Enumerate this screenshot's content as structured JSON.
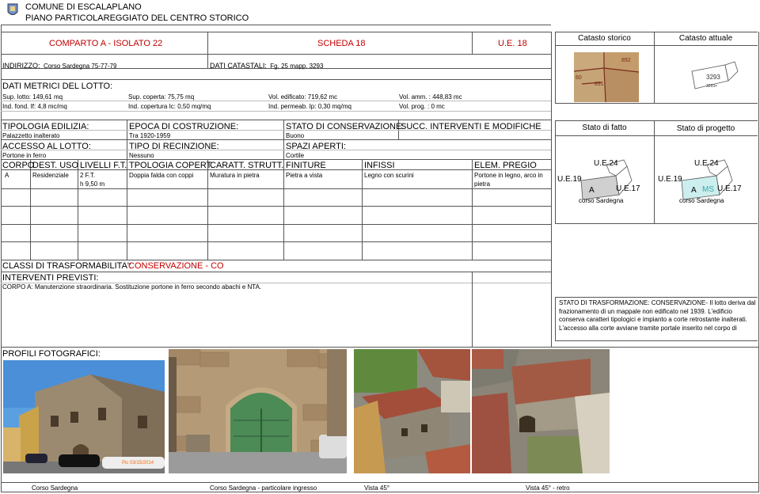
{
  "header": {
    "comune": "COMUNE DI ESCALAPLANO",
    "piano": "PIANO PARTICOLAREGGIATO DEL CENTRO STORICO"
  },
  "title_row": {
    "comparto": "COMPARTO A - ISOLATO 22",
    "scheda": "SCHEDA 18",
    "ue": "U.E. 18"
  },
  "address": {
    "label": "INDIRIZZO:",
    "value": "Corso Sardegna 75-77-79",
    "catasto_label": "DATI CATASTALI:",
    "catasto_value": "Fg. 25 mapp.  3293"
  },
  "metrics": {
    "title": "DATI METRICI DEL LOTTO:",
    "row1": [
      "Sup. lotto: 149,61 mq",
      "Sup. coperta:  75,75 mq",
      "Vol. edificato: 719,62 mc",
      "Vol. amm. : 448,83 mc"
    ],
    "row2": [
      "Ind. fond. If: 4,8 mc/mq",
      "Ind. copertura Ic: 0,50 mq/mq",
      "Ind. permeab. Ip: 0,30 mq/mq",
      "Vol. prog. : 0 mc"
    ]
  },
  "typology": {
    "tip_label": "TIPOLOGIA EDILIZIA:",
    "tip_value": "Palazzetto inalterato",
    "epoca_label": "EPOCA DI COSTRUZIONE:",
    "epoca_value": "Tra 1920-1959",
    "stato_label": "STATO DI CONSERVAZIONE:",
    "stato_value": "Buono",
    "succ_label": "SUCC. INTERVENTI E MODIFICHE",
    "accesso_label": "ACCESSO AL LOTTO:",
    "accesso_value": "Portone in ferro",
    "recinzione_label": "TIPO DI RECINZIONE:",
    "recinzione_value": "Nessuno",
    "spazi_label": "SPAZI APERTI:",
    "spazi_value": "Cortile"
  },
  "table": {
    "headers": [
      "CORPO",
      "DEST. USO",
      "LIVELLI F.T.",
      "TPOLOGIA COPERT.",
      "CARATT. STRUTT.",
      "FINITURE",
      "INFISSI",
      "ELEM. PREGIO"
    ],
    "row": {
      "corpo": "A",
      "dest": "Residenziale",
      "livelli1": "2 F.T.",
      "livelli2": "h 9,50 m",
      "copert": "Doppia falda con coppi",
      "strutt": "Muratura in pietra",
      "finiture": "Pietra a vista",
      "infissi": "Legno con scurini",
      "pregio1": "Portone in legno,  arco in",
      "pregio2": "pietra"
    }
  },
  "trasf": {
    "label": "CLASSI DI TRASFORMABILITA':",
    "value": "CONSERVAZIONE - CO",
    "interventi_label": "INTERVENTI PREVISTI:",
    "interventi_value": "CORPO A: Manutenzione straordinaria. Sostituzione portone in ferro secondo abachi e NTA."
  },
  "profili": {
    "label": "PROFILI FOTOGRAFICI:",
    "captions": [
      "Corso Sardegna",
      "Corso  Sardegna - particolare ingresso",
      "Vista 45°",
      "Vista 45° - retro"
    ],
    "photo_stamp": "Pic 03/15/2014"
  },
  "right_panel": {
    "catasto_storico": "Catasto storico",
    "catasto_attuale": "Catasto attuale",
    "storico_labels": [
      "892",
      "60",
      "891"
    ],
    "attuale_labels": [
      "3293",
      "3293+"
    ],
    "stato_fatto": "Stato di fatto",
    "stato_progetto": "Stato di progetto",
    "fatto": {
      "ue24": "U.E.24",
      "ue19": "U.E.19",
      "ue17": "U.E.17",
      "a": "A",
      "street": "corso Sardegna"
    },
    "progetto": {
      "ue24": "U.E.24",
      "ue19": "U.E.19",
      "ue17": "U.E.17",
      "a": "A",
      "ms": "MS",
      "street": "corso Sardegna"
    },
    "trasformazione_note": "STATO DI TRASFORMAZIONE:  CONSERVAZIONE- Il lotto  deriva dal frazionamento di un mappale non edificato nel 1939. L'edificio conserva caratteri tipologici e impianto a corte retrostante inalterati. L'accesso alla corte avviane tramite portale inserito nel corpo di"
  },
  "colors": {
    "red": "#c00000",
    "teal": "#3aa6a6",
    "brown": "#a0522d"
  }
}
